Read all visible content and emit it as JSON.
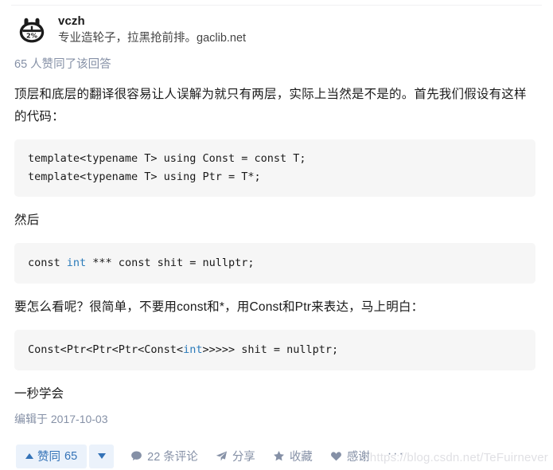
{
  "author": {
    "avatar_icon": "rabbit-2-percent-avatar",
    "name": "vczh",
    "bio": "专业造轮子，拉黑抢前排。gaclib.net"
  },
  "voters_line": "65 人赞同了该回答",
  "content": {
    "paragraph_1": "顶层和底层的翻译很容易让人误解为就只有两层，实际上当然是不是的。首先我们假设有这样的代码：",
    "code_1_line_1": "template<typename T> using Const = const T;",
    "code_1_line_2": "template<typename T> using Ptr = T*;",
    "paragraph_2": "然后",
    "code_2_prefix": "const ",
    "code_2_keyword": "int",
    "code_2_suffix": " *** const shit = nullptr;",
    "paragraph_3": "要怎么看呢？很简单，不要用const和*，用Const和Ptr来表达，马上明白：",
    "code_3_prefix": "Const<Ptr<Ptr<Ptr<Const<",
    "code_3_keyword": "int",
    "code_3_suffix": ">>>>> shit = nullptr;",
    "closing": "一秒学会",
    "edit_time": "编辑于 2017-10-03"
  },
  "actions": {
    "upvote_label": "赞同",
    "upvote_count": "65",
    "upvote_icon": "triangle-up-icon",
    "downvote_icon": "triangle-down-icon",
    "comment_icon": "comment-bubble-icon",
    "comment_label": "22 条评论",
    "share_icon": "paper-plane-icon",
    "share_label": "分享",
    "favorite_icon": "star-icon",
    "favorite_label": "收藏",
    "thanks_icon": "heart-icon",
    "thanks_label": "感谢",
    "more_label": "···"
  },
  "watermark": "https://blog.csdn.net/TeFuirnever",
  "colors": {
    "accent_blue": "#3372b7",
    "vote_bg": "#ebf2fb",
    "muted": "#8590a6",
    "code_bg": "#f6f6f6",
    "code_keyword": "#2b7bba",
    "watermark": "#e0e0e4"
  }
}
